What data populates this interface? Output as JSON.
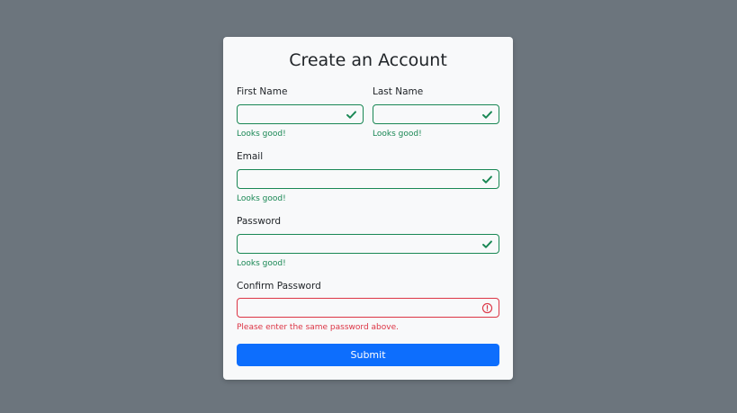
{
  "form": {
    "title": "Create an Account",
    "fields": {
      "first_name": {
        "label": "First Name",
        "value": "",
        "feedback": "Looks good!",
        "state": "valid"
      },
      "last_name": {
        "label": "Last Name",
        "value": "",
        "feedback": "Looks good!",
        "state": "valid"
      },
      "email": {
        "label": "Email",
        "value": "",
        "feedback": "Looks good!",
        "state": "valid"
      },
      "password": {
        "label": "Password",
        "value": "",
        "feedback": "Looks good!",
        "state": "valid"
      },
      "confirm_password": {
        "label": "Confirm Password",
        "value": "",
        "feedback": "Please enter the same password above.",
        "state": "invalid"
      }
    },
    "submit_label": "Submit"
  },
  "icons": {
    "valid": "check-icon",
    "invalid": "alert-circle-icon"
  },
  "colors": {
    "page_background": "#6c757d",
    "card_background": "#f8f9fa",
    "valid": "#198754",
    "invalid": "#dc3545",
    "primary": "#0d6efd"
  }
}
